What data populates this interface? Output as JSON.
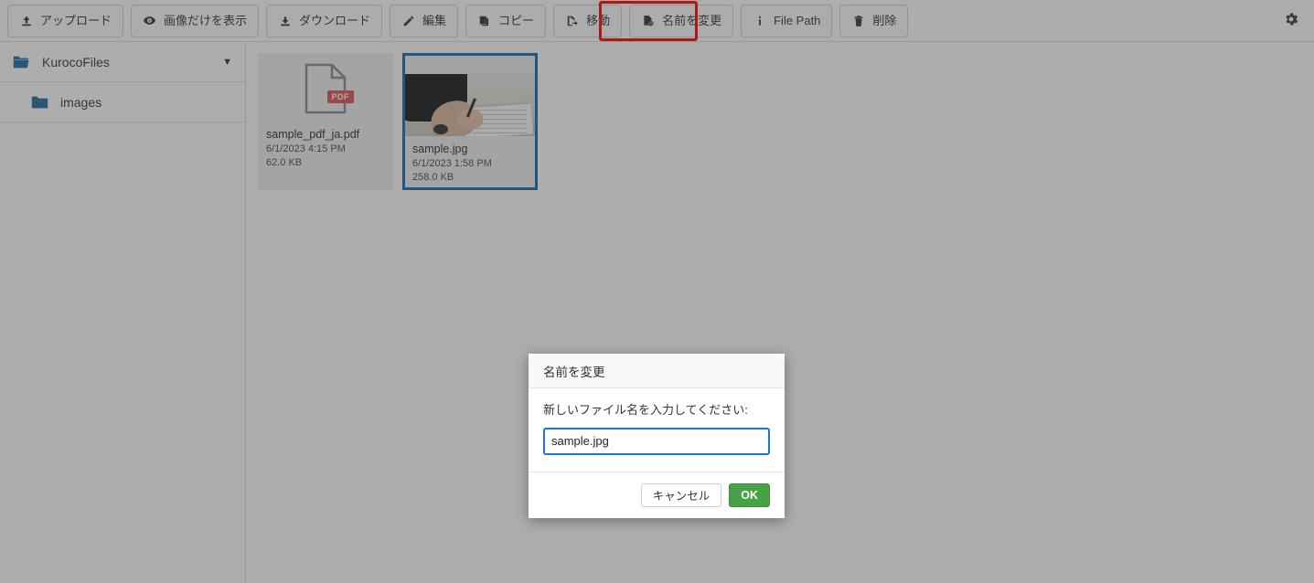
{
  "toolbar": {
    "buttons": [
      {
        "id": "upload",
        "label": "アップロード",
        "icon": "upload-icon"
      },
      {
        "id": "images-only",
        "label": "画像だけを表示",
        "icon": "eye-icon"
      },
      {
        "id": "download",
        "label": "ダウンロード",
        "icon": "download-icon"
      },
      {
        "id": "edit",
        "label": "編集",
        "icon": "pencil-icon"
      },
      {
        "id": "copy",
        "label": "コピー",
        "icon": "copy-icon"
      },
      {
        "id": "move",
        "label": "移動",
        "icon": "move-file-icon"
      },
      {
        "id": "rename",
        "label": "名前を変更",
        "icon": "rename-file-icon"
      },
      {
        "id": "file-path",
        "label": "File Path",
        "icon": "info-icon"
      },
      {
        "id": "delete",
        "label": "削除",
        "icon": "trash-icon"
      }
    ],
    "settings_icon": "gear-icon",
    "highlight_color": "#ff0000",
    "highlighted_button": "rename"
  },
  "sidebar": {
    "items": [
      {
        "label": "KurocoFiles",
        "icon": "folder-open-icon",
        "caret": "▼",
        "level": 0
      },
      {
        "label": "images",
        "icon": "folder-icon",
        "caret": "",
        "level": 1
      }
    ]
  },
  "files": [
    {
      "name": "sample_pdf_ja.pdf",
      "date": "6/1/2023 4:15 PM",
      "size": "62.0 KB",
      "kind": "pdf",
      "badge": "PDF",
      "selected": false
    },
    {
      "name": "sample.jpg",
      "date": "6/1/2023 1:58 PM",
      "size": "258.0 KB",
      "kind": "image",
      "badge": "",
      "selected": true
    }
  ],
  "dialog": {
    "title": "名前を変更",
    "prompt": "新しいファイル名を入力してください:",
    "input_value": "sample.jpg",
    "input_placeholder": "",
    "cancel_label": "キャンセル",
    "ok_label": "OK",
    "ok_color": "#47a245",
    "input_focus_color": "#1779d0"
  },
  "colors": {
    "selection_border": "#1668ad",
    "pdf_badge": "#e05252",
    "folder_blue": "#1b6ca8"
  }
}
